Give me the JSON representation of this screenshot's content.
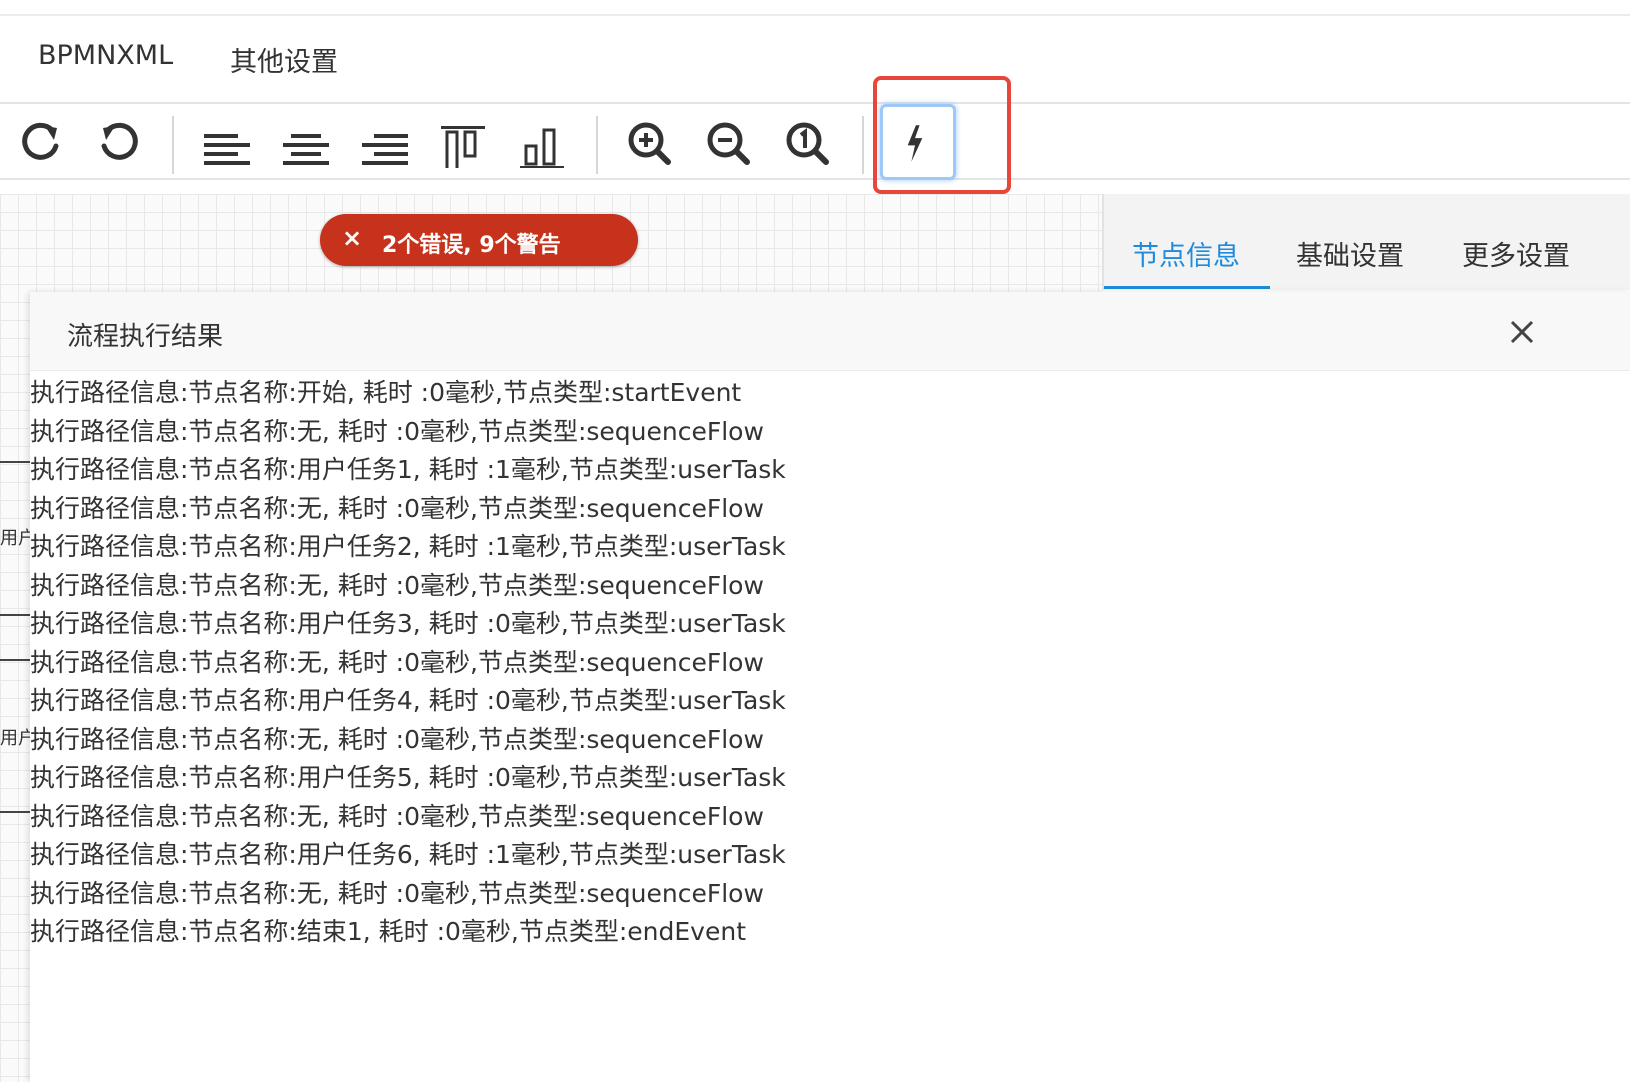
{
  "menu": {
    "bpmnxml": "BPMNXML",
    "other_settings": "其他设置"
  },
  "toolbar": {
    "icons": [
      "redo-icon",
      "undo-icon",
      "align-left-icon",
      "align-center-icon",
      "align-right-icon",
      "align-top-icon",
      "align-bottom-icon",
      "zoom-in-icon",
      "zoom-out-icon",
      "zoom-reset-icon",
      "run-icon"
    ]
  },
  "validation": {
    "badge_icon": "×",
    "badge_text": "2个错误, 9个警告"
  },
  "properties": {
    "tabs": [
      "节点信息",
      "基础设置",
      "更多设置"
    ],
    "active_tab": 0
  },
  "canvas_fragments": {
    "user_label": "用户"
  },
  "result": {
    "title": "流程执行结果",
    "close": "×",
    "lines": [
      "执行路径信息:节点名称:开始, 耗时 :0毫秒,节点类型:startEvent",
      "执行路径信息:节点名称:无, 耗时 :0毫秒,节点类型:sequenceFlow",
      "执行路径信息:节点名称:用户任务1, 耗时 :1毫秒,节点类型:userTask",
      "执行路径信息:节点名称:无, 耗时 :0毫秒,节点类型:sequenceFlow",
      "执行路径信息:节点名称:用户任务2, 耗时 :1毫秒,节点类型:userTask",
      "执行路径信息:节点名称:无, 耗时 :0毫秒,节点类型:sequenceFlow",
      "执行路径信息:节点名称:用户任务3, 耗时 :0毫秒,节点类型:userTask",
      "执行路径信息:节点名称:无, 耗时 :0毫秒,节点类型:sequenceFlow",
      "执行路径信息:节点名称:用户任务4, 耗时 :0毫秒,节点类型:userTask",
      "执行路径信息:节点名称:无, 耗时 :0毫秒,节点类型:sequenceFlow",
      "执行路径信息:节点名称:用户任务5, 耗时 :0毫秒,节点类型:userTask",
      "执行路径信息:节点名称:无, 耗时 :0毫秒,节点类型:sequenceFlow",
      "执行路径信息:节点名称:用户任务6, 耗时 :1毫秒,节点类型:userTask",
      "执行路径信息:节点名称:无, 耗时 :0毫秒,节点类型:sequenceFlow",
      "执行路径信息:节点名称:结束1, 耗时 :0毫秒,节点类型:endEvent"
    ]
  },
  "colors": {
    "accent": "#1f8bdc",
    "error": "#c6321b",
    "highlight": "#e8463b"
  }
}
